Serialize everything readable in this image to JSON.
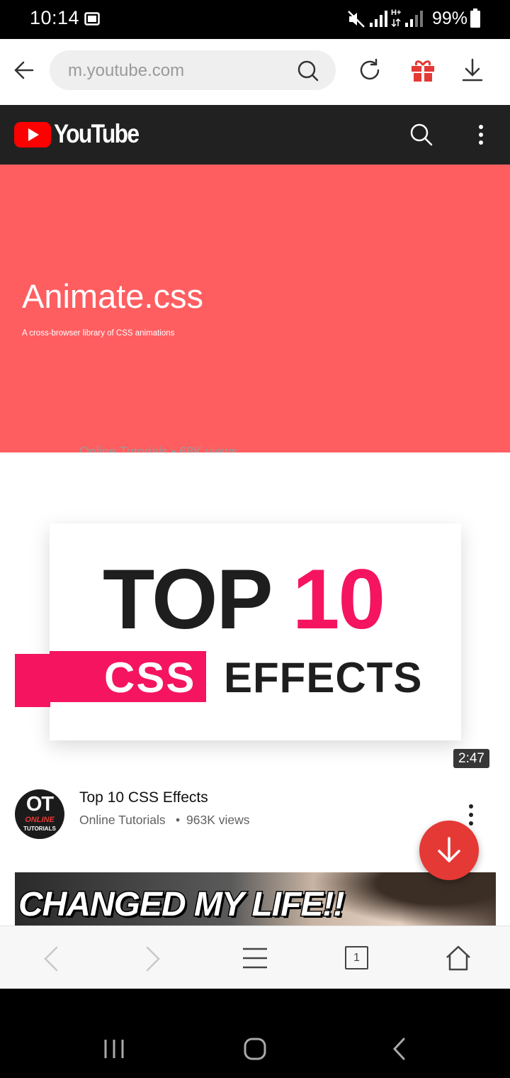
{
  "status_bar": {
    "time": "10:14",
    "battery": "99%",
    "network": "H+"
  },
  "browser": {
    "url": "m.youtube.com",
    "icons": [
      "back-arrow-icon",
      "search-icon",
      "reload-icon",
      "gift-icon",
      "download-icon"
    ],
    "accent_color": "#e53935"
  },
  "youtube": {
    "wordmark": "YouTube",
    "brand_color": "#ff0000",
    "header_bg": "#212121"
  },
  "hero": {
    "title": "Animate.css",
    "subtitle": "A cross-browser library of CSS animations",
    "background": "#ff5e61"
  },
  "previous_video_meta": "Online Tutorials • 68K views",
  "video": {
    "thumbnail": {
      "line1_a": "TOP",
      "line1_b": "10",
      "line2_a": "CSS",
      "line2_b": "EFFECTS",
      "accent": "#f5145f"
    },
    "duration": "2:47",
    "title": "Top 10 CSS Effects",
    "channel": "Online Tutorials",
    "separator": "•",
    "views": "963K views",
    "avatar": {
      "line1": "OT",
      "line2": "ONLINE",
      "line3": "TUTORIALS"
    }
  },
  "next_video": {
    "thumbnail_text": "CHANGED MY LIFE!!"
  },
  "browser_nav": {
    "tab_count": "1"
  }
}
